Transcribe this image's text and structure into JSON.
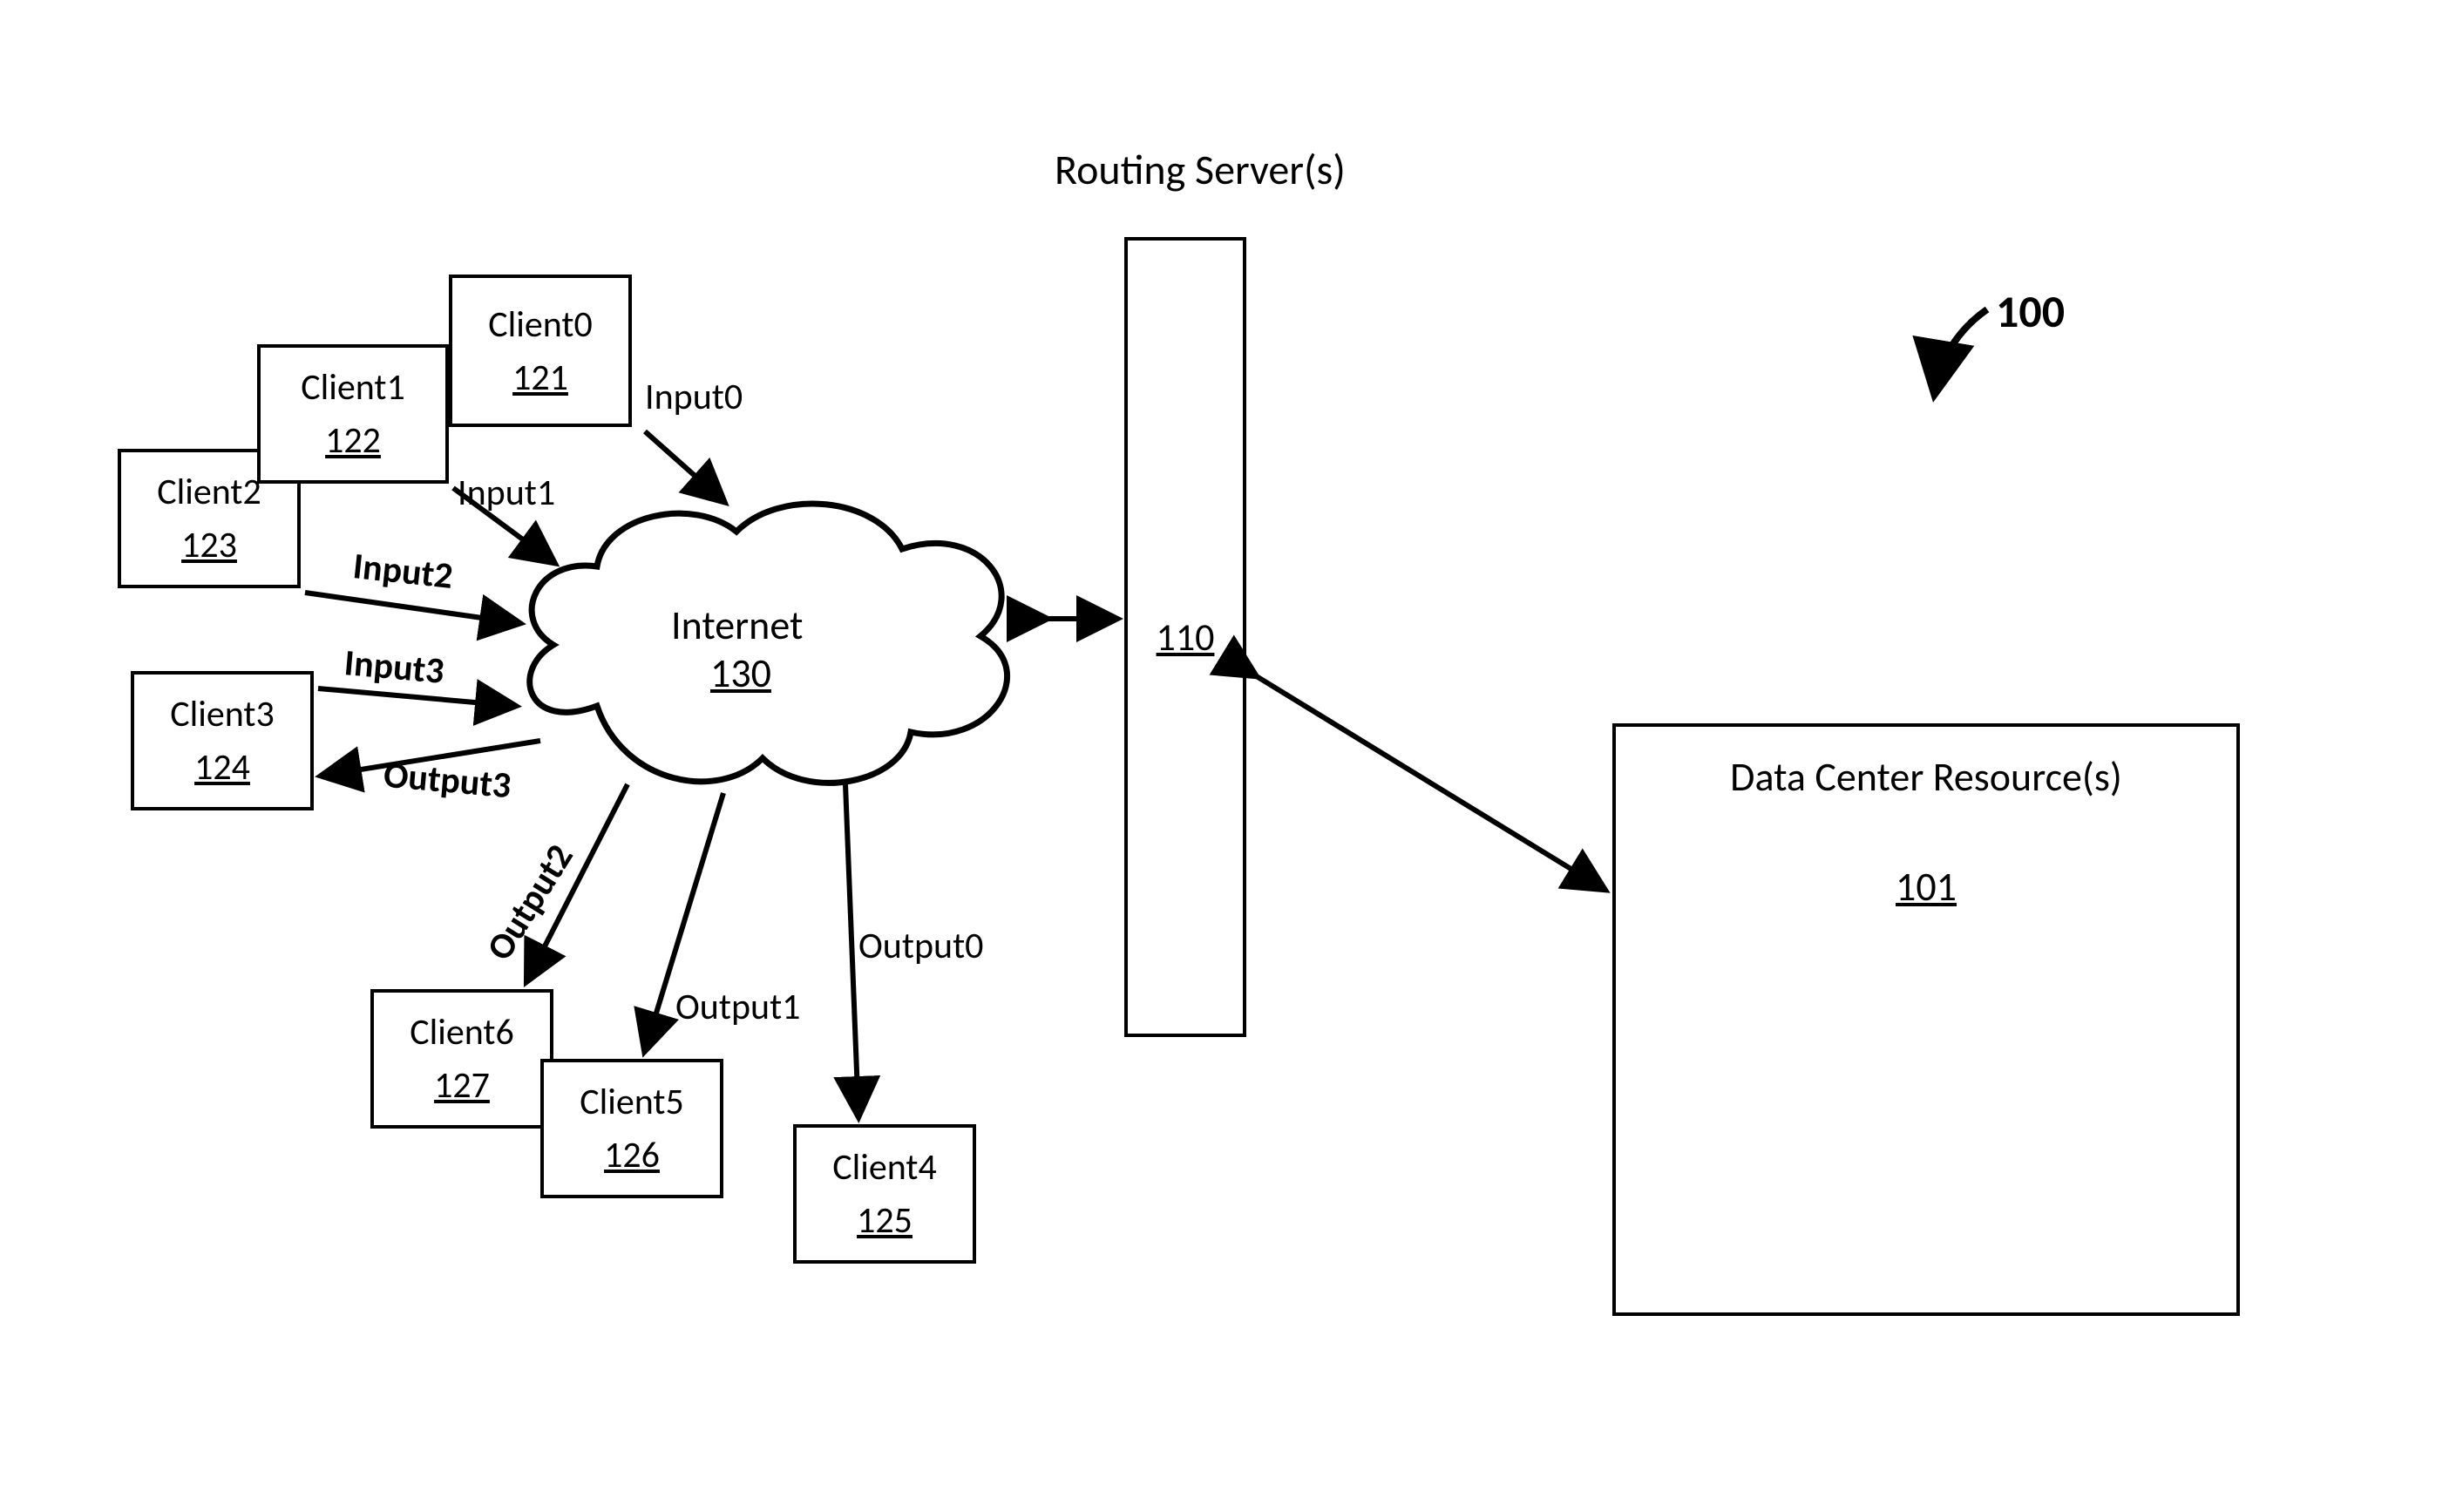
{
  "figure_number": "100",
  "routing_server": {
    "title": "Routing Server(s)",
    "ref": "110"
  },
  "datacenter": {
    "title": "Data Center Resource(s)",
    "ref": "101"
  },
  "internet": {
    "title": "Internet",
    "ref": "130"
  },
  "clients": {
    "c0": {
      "name": "Client0",
      "ref": "121"
    },
    "c1": {
      "name": "Client1",
      "ref": "122"
    },
    "c2": {
      "name": "Client2",
      "ref": "123"
    },
    "c3": {
      "name": "Client3",
      "ref": "124"
    },
    "c4": {
      "name": "Client4",
      "ref": "125"
    },
    "c5": {
      "name": "Client5",
      "ref": "126"
    },
    "c6": {
      "name": "Client6",
      "ref": "127"
    }
  },
  "arrows": {
    "in0": "Input0",
    "in1": "Input1",
    "in2": "Input2",
    "in3": "Input3",
    "out0": "Output0",
    "out1": "Output1",
    "out2": "Output2",
    "out3": "Output3"
  }
}
